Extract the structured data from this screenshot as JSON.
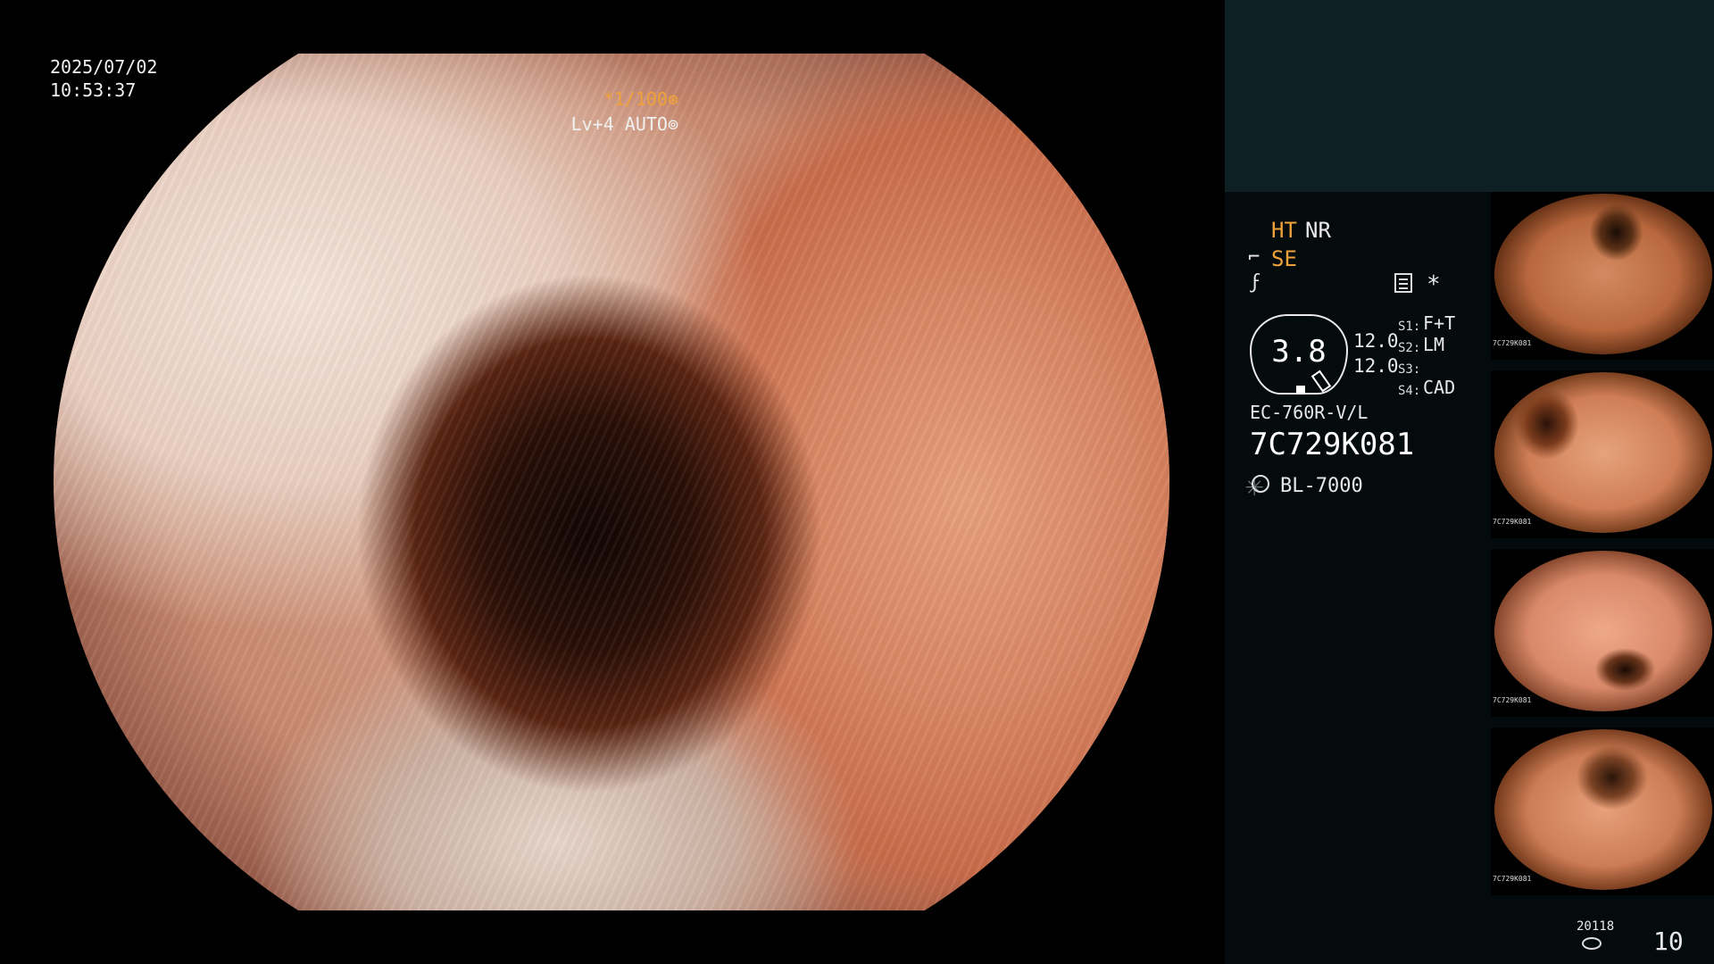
{
  "overlay": {
    "date": "2025/07/02",
    "time": "10:53:37",
    "shutter": "*1/100⊛",
    "level": "Lv+4 AUTO⊚"
  },
  "panel": {
    "ht": "HT",
    "nr": "NR",
    "se": "SE",
    "se_icon": "scope-tip-icon",
    "flash_icon": "flash-icon",
    "note_icon": "note-icon",
    "asterisk": "*",
    "gauge_value": "3.8",
    "value1": "12.0",
    "value2": "12.0",
    "s1_label": "S1:",
    "s1_value": "F+T",
    "s2_label": "S2:",
    "s2_value": "LM",
    "s3_label": "S3:",
    "s3_value": "",
    "s4_label": "S4:",
    "s4_value": "CAD",
    "scope_model": "EC-760R-V/L",
    "scope_serial": "7C729K081",
    "lamp_icon": "lamp-icon",
    "lamp_model": "BL-7000",
    "thumb_code": "7C729K081",
    "counter_code": "20118",
    "disk_icon": "disk-icon",
    "image_count": "10"
  },
  "colors": {
    "accent": "#f0a23a",
    "panel_top_bg": "#0e2024",
    "panel_bottom_bg": "#030b0c"
  }
}
